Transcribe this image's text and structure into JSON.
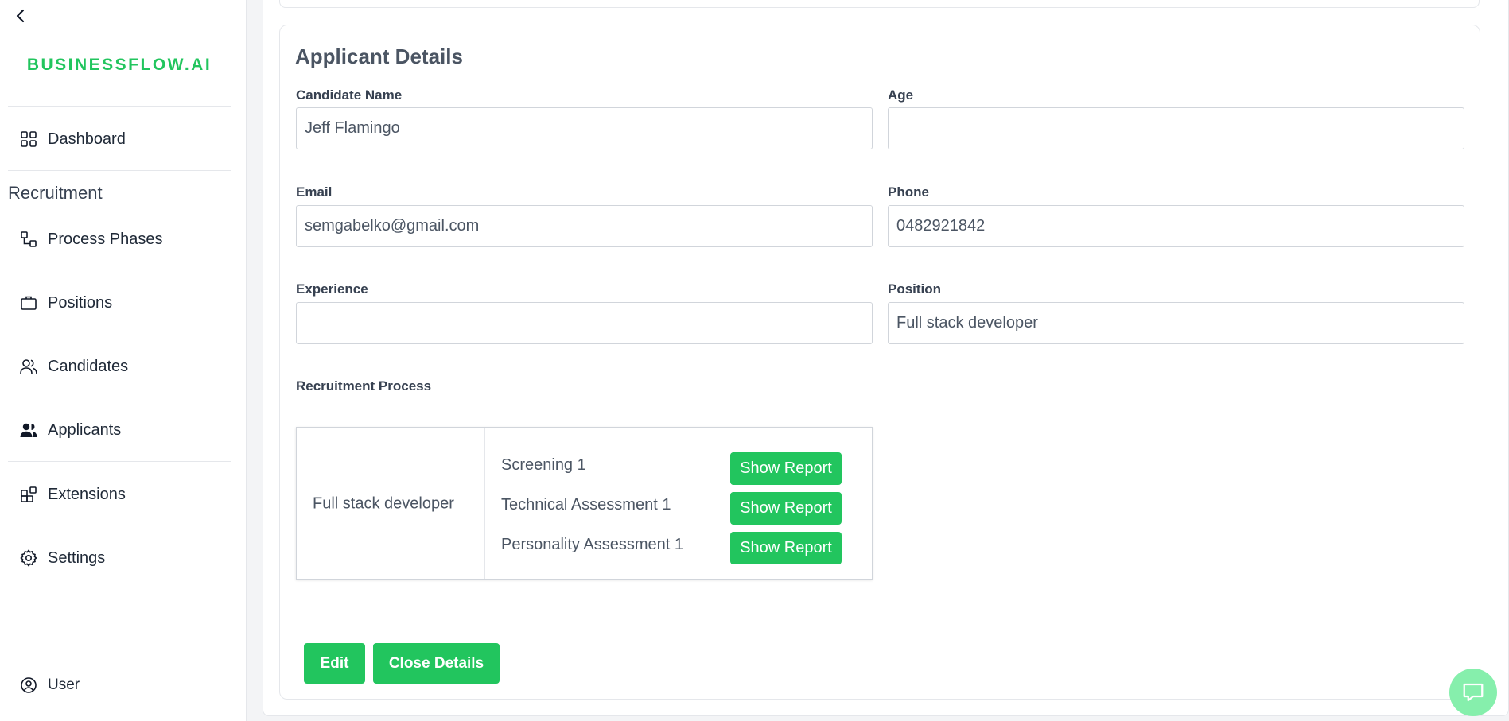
{
  "sidebar": {
    "brand": "BUSINESSFLOW.AI",
    "dashboard": "Dashboard",
    "section_title": "Recruitment",
    "process_phases": "Process Phases",
    "positions": "Positions",
    "candidates": "Candidates",
    "applicants": "Applicants",
    "extensions": "Extensions",
    "settings": "Settings",
    "user": "User"
  },
  "details": {
    "title": "Applicant Details",
    "candidate_name_label": "Candidate Name",
    "candidate_name_value": "Jeff Flamingo",
    "age_label": "Age",
    "age_value": "",
    "email_label": "Email",
    "email_value": "semgabelko@gmail.com",
    "phone_label": "Phone",
    "phone_value": "0482921842",
    "experience_label": "Experience",
    "experience_value": "",
    "position_label": "Position",
    "position_value": "Full stack developer"
  },
  "process": {
    "label": "Recruitment Process",
    "position": "Full stack developer",
    "phases": [
      {
        "name": "Screening 1",
        "button": "Show Report"
      },
      {
        "name": "Technical Assessment 1",
        "button": "Show Report"
      },
      {
        "name": "Personality Assessment 1",
        "button": "Show Report"
      }
    ]
  },
  "actions": {
    "edit": "Edit",
    "close_details": "Close Details"
  },
  "colors": {
    "accent": "#22c55e",
    "chat_bubble": "#86efac"
  }
}
